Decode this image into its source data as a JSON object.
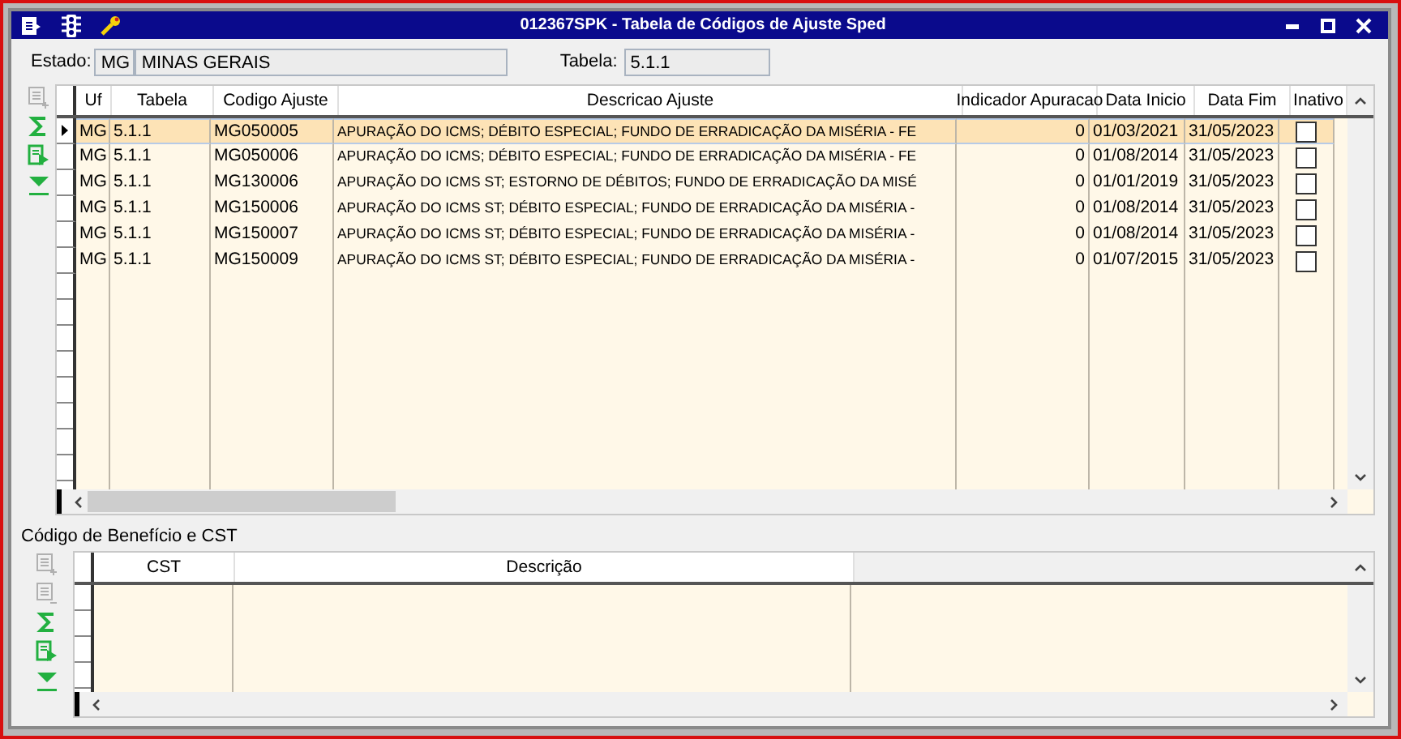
{
  "window": {
    "title": "012367SPK - Tabela de Códigos de Ajuste Sped"
  },
  "header_fields": {
    "estado_label": "Estado:",
    "estado_code": "MG",
    "estado_name": "MINAS GERAIS",
    "tabela_label": "Tabela:",
    "tabela": "5.1.1"
  },
  "grid": {
    "toolbar": [
      {
        "kind": "add",
        "disabled": true
      },
      {
        "kind": "sum",
        "disabled": false
      },
      {
        "kind": "export",
        "disabled": false
      },
      {
        "kind": "filter",
        "disabled": false
      }
    ],
    "columns": [
      "Uf",
      "Tabela",
      "Codigo Ajuste",
      "Descricao Ajuste",
      "Indicador Apuracao",
      "Data Inicio",
      "Data Fim",
      "Inativo"
    ],
    "rows": [
      {
        "selected": true,
        "uf": "MG",
        "tabela": "5.1.1",
        "codigo": "MG050005",
        "descricao": "APURAÇÃO DO ICMS; DÉBITO ESPECIAL; FUNDO DE ERRADICAÇÃO DA MISÉRIA - FE",
        "indicador": "0",
        "data_inicio": "01/03/2021",
        "data_fim": "31/05/2023",
        "inativo": false
      },
      {
        "selected": false,
        "uf": "MG",
        "tabela": "5.1.1",
        "codigo": "MG050006",
        "descricao": "APURAÇÃO DO ICMS; DÉBITO ESPECIAL; FUNDO DE ERRADICAÇÃO DA MISÉRIA - FE",
        "indicador": "0",
        "data_inicio": "01/08/2014",
        "data_fim": "31/05/2023",
        "inativo": false
      },
      {
        "selected": false,
        "uf": "MG",
        "tabela": "5.1.1",
        "codigo": "MG130006",
        "descricao": "APURAÇÃO DO ICMS ST; ESTORNO DE DÉBITOS; FUNDO DE ERRADICAÇÃO DA MISÉ",
        "indicador": "0",
        "data_inicio": "01/01/2019",
        "data_fim": "31/05/2023",
        "inativo": false
      },
      {
        "selected": false,
        "uf": "MG",
        "tabela": "5.1.1",
        "codigo": "MG150006",
        "descricao": "APURAÇÃO DO ICMS ST; DÉBITO ESPECIAL; FUNDO DE ERRADICAÇÃO DA MISÉRIA -",
        "indicador": "0",
        "data_inicio": "01/08/2014",
        "data_fim": "31/05/2023",
        "inativo": false
      },
      {
        "selected": false,
        "uf": "MG",
        "tabela": "5.1.1",
        "codigo": "MG150007",
        "descricao": "APURAÇÃO DO ICMS ST; DÉBITO ESPECIAL; FUNDO DE ERRADICAÇÃO DA MISÉRIA -",
        "indicador": "0",
        "data_inicio": "01/08/2014",
        "data_fim": "31/05/2023",
        "inativo": false
      },
      {
        "selected": false,
        "uf": "MG",
        "tabela": "5.1.1",
        "codigo": "MG150009",
        "descricao": "APURAÇÃO DO ICMS ST; DÉBITO ESPECIAL; FUNDO DE ERRADICAÇÃO DA MISÉRIA -",
        "indicador": "0",
        "data_inicio": "01/07/2015",
        "data_fim": "31/05/2023",
        "inativo": false
      }
    ]
  },
  "sub_grid": {
    "title": "Código de Benefício e CST",
    "toolbar": [
      {
        "kind": "add",
        "disabled": true
      },
      {
        "kind": "remove",
        "disabled": true
      },
      {
        "kind": "sum",
        "disabled": false
      },
      {
        "kind": "export",
        "disabled": false
      },
      {
        "kind": "filter",
        "disabled": false
      }
    ],
    "columns": [
      "CST",
      "Descrição"
    ]
  }
}
